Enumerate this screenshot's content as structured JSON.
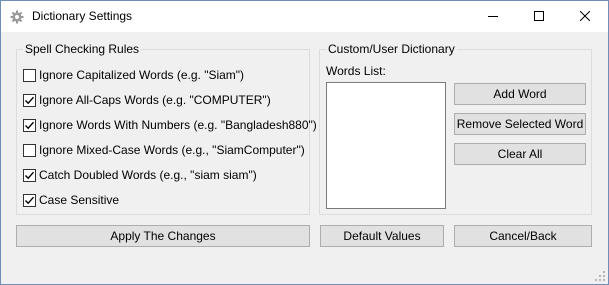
{
  "window": {
    "title": "Dictionary Settings",
    "app_icon": "gear-icon",
    "controls": [
      "minimize-icon",
      "maximize-icon",
      "close-icon"
    ]
  },
  "spell_rules": {
    "title": "Spell Checking Rules",
    "options": [
      {
        "label": "Ignore Capitalized Words (e.g. \"Siam\")",
        "checked": false
      },
      {
        "label": "Ignore All-Caps Words (e.g. \"COMPUTER\")",
        "checked": true
      },
      {
        "label": "Ignore Words With Numbers (e.g. \"Bangladesh880\")",
        "checked": true
      },
      {
        "label": "Ignore Mixed-Case Words (e.g., \"SiamComputer\")",
        "checked": false
      },
      {
        "label": "Catch Doubled Words (e.g., \"siam siam\")",
        "checked": true
      },
      {
        "label": "Case Sensitive",
        "checked": true
      }
    ]
  },
  "dictionary": {
    "title": "Custom/User Dictionary",
    "words_label": "Words List:",
    "words": [],
    "add_label": "Add Word",
    "remove_label": "Remove Selected Word",
    "clear_label": "Clear All"
  },
  "footer": {
    "apply_label": "Apply The Changes",
    "default_label": "Default Values",
    "cancel_label": "Cancel/Back"
  }
}
